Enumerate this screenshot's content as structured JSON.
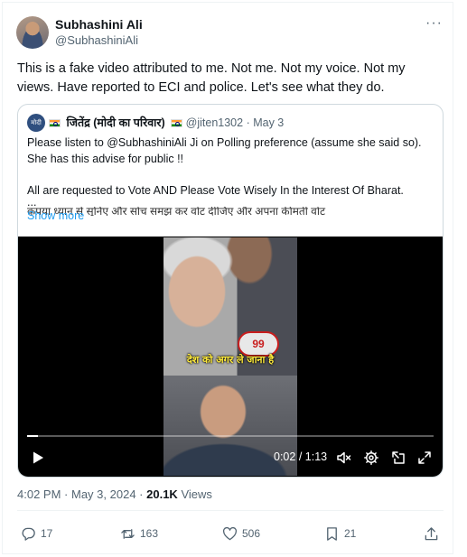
{
  "tweet": {
    "author_name": "Subhashini Ali",
    "author_handle": "@SubhashiniAli",
    "more_icon": "more-dots-icon",
    "text": "This is a fake video attributed to me. Not me. Not my voice. Not my views. Have reported to ECI and police. Let's see what they do.",
    "time": "4:02 PM",
    "date": "May 3, 2024",
    "views_count": "20.1K",
    "views_label": "Views"
  },
  "quoted": {
    "avatar_text": "मोदी",
    "author_name": "जितेंद्र (मोदी का परिवार)",
    "author_handle": "@jiten1302",
    "date": "May 3",
    "line1": "Please listen to @SubhashiniAli  Ji on Polling preference (assume she said so).",
    "line2": "She has this advise for public !!",
    "line3": "All are requested to Vote AND Please Vote Wisely In the Interest Of Bharat.",
    "line4": "...",
    "line5_cut": "कृपया ध्यान से सुनिए और सोच समझ कर वोट दीजिए और अपना कीमती वोट",
    "show_more": "Show more"
  },
  "video": {
    "mic_label": "99",
    "caption": "देश को अगर ले जाना है",
    "current_time": "0:02",
    "duration": "1:13",
    "progress": 0.026
  },
  "actions": {
    "replies": "17",
    "reposts": "163",
    "likes": "506",
    "bookmarks": "21"
  },
  "colors": {
    "text": "#0f1419",
    "secondary": "#536471",
    "link": "#1d9bf0",
    "border": "#cfd9de"
  }
}
